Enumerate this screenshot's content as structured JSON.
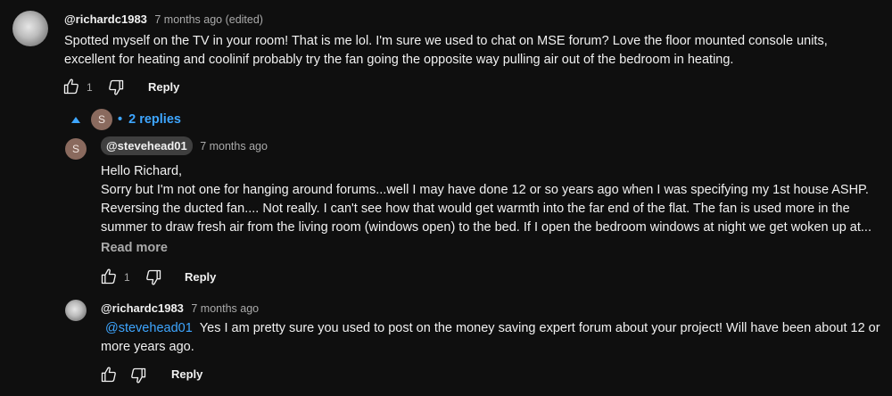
{
  "comment": {
    "author": "@richardc1983",
    "time": "7 months ago (edited)",
    "text": "Spotted myself on the TV in your room! That is me lol. I'm sure we used to chat on MSE forum? Love the floor mounted console units, excellent for heating and coolinif probably try the fan going the opposite way pulling air out of the bedroom in heating.",
    "likes": "1",
    "reply_label": "Reply"
  },
  "replies_toggle": {
    "avatar_letter": "S",
    "dot": "•",
    "label": "2 replies"
  },
  "replies": [
    {
      "avatar_letter": "S",
      "author": "@stevehead01",
      "time": "7 months ago",
      "lines": [
        "Hello Richard,",
        "Sorry but I'm not one for hanging around forums...well I may have done 12 or so years ago when I was specifying my 1st house ASHP.",
        "Reversing the ducted fan.... Not really. I can't see how that would get warmth into the far end of the flat. The fan is used more in the",
        "summer to draw fresh air from the living room (windows open) to the bed. If I open the bedroom windows at night we get woken up at..."
      ],
      "read_more": "Read more",
      "likes": "1",
      "reply_label": "Reply"
    },
    {
      "author": "@richardc1983",
      "time": "7 months ago",
      "mention": "@stevehead01",
      "text": "Yes I am pretty sure you used to post on the money saving expert forum about your project! Will have been about 12 or more years ago.",
      "reply_label": "Reply"
    }
  ],
  "icons": {
    "like": "thumbs-up-icon",
    "dislike": "thumbs-down-icon",
    "collapse": "caret-up-icon"
  },
  "colors": {
    "background": "#0f0f0f",
    "link": "#3ea6ff",
    "secondary_text": "#aaaaaa"
  }
}
